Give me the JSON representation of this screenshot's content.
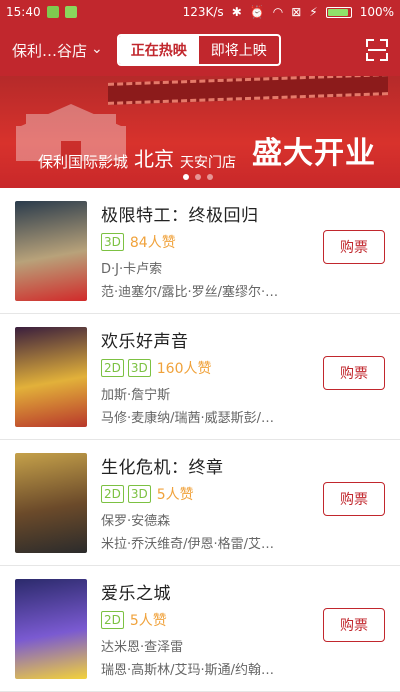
{
  "status_bar": {
    "time": "15:40",
    "network_speed": "123K/s",
    "battery_percent": "100%",
    "icons": [
      "app-notification-icon",
      "android-icon",
      "bluetooth-icon",
      "alarm-off-icon",
      "wifi-icon",
      "sim-off-icon",
      "charging-icon",
      "battery-icon"
    ]
  },
  "header": {
    "cinema_name": "保利…谷店",
    "tabs": [
      {
        "label": "正在热映",
        "active": true
      },
      {
        "label": "即将上映",
        "active": false
      }
    ]
  },
  "banner": {
    "text1": "保利国际影城",
    "text2": "北京",
    "text3": "天安门店",
    "text4": "盛大开业",
    "page_dots": 3,
    "active_dot": 0
  },
  "movies": [
    {
      "title": "极限特工：终极回归",
      "formats": [
        "3D"
      ],
      "likes": "84人赞",
      "director": "D·J·卡卢索",
      "cast": "范·迪塞尔/露比·罗丝/塞缪尔·…",
      "buy_label": "购票",
      "poster_colors": [
        "#2a3b4c",
        "#b8a27a",
        "#d12a2a"
      ]
    },
    {
      "title": "欢乐好声音",
      "formats": [
        "2D",
        "3D"
      ],
      "likes": "160人赞",
      "director": "加斯·詹宁斯",
      "cast": "马修·麦康纳/瑞茜·威瑟斯彭/…",
      "buy_label": "购票",
      "poster_colors": [
        "#3a1e3d",
        "#e2b13a",
        "#b8372b"
      ]
    },
    {
      "title": "生化危机：终章",
      "formats": [
        "2D",
        "3D"
      ],
      "likes": "5人赞",
      "director": "保罗·安德森",
      "cast": "米拉·乔沃维奇/伊恩·格雷/艾…",
      "buy_label": "购票",
      "poster_colors": [
        "#c5a14a",
        "#6b4a2a",
        "#2b2b2b"
      ]
    },
    {
      "title": "爱乐之城",
      "formats": [
        "2D"
      ],
      "likes": "5人赞",
      "director": "达米恩·查泽雷",
      "cast": "瑞恩·高斯林/艾玛·斯通/约翰…",
      "buy_label": "购票",
      "poster_colors": [
        "#2b2a6b",
        "#7a5ad1",
        "#f3d23a"
      ]
    }
  ],
  "colors": {
    "brand_red": "#c1272d",
    "format_green": "#7cc142",
    "likes_orange": "#f0a23b"
  }
}
